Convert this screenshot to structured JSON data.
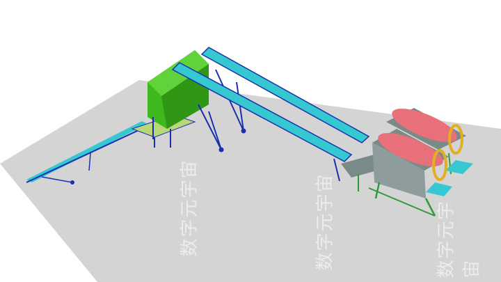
{
  "scene": {
    "description_free": true,
    "colors": {
      "background": "#ffffff",
      "floor": "#d4d4d4",
      "frame": "#1a2fb0",
      "belt": "#35c8d0",
      "hopper": "#3db81e",
      "drum_body": "#e8707a",
      "drum_ring": "#e0b020",
      "screen_housing": "#7a8a88",
      "support": "#2e9a3a"
    }
  },
  "watermark": {
    "text": "数字元宇宙"
  }
}
